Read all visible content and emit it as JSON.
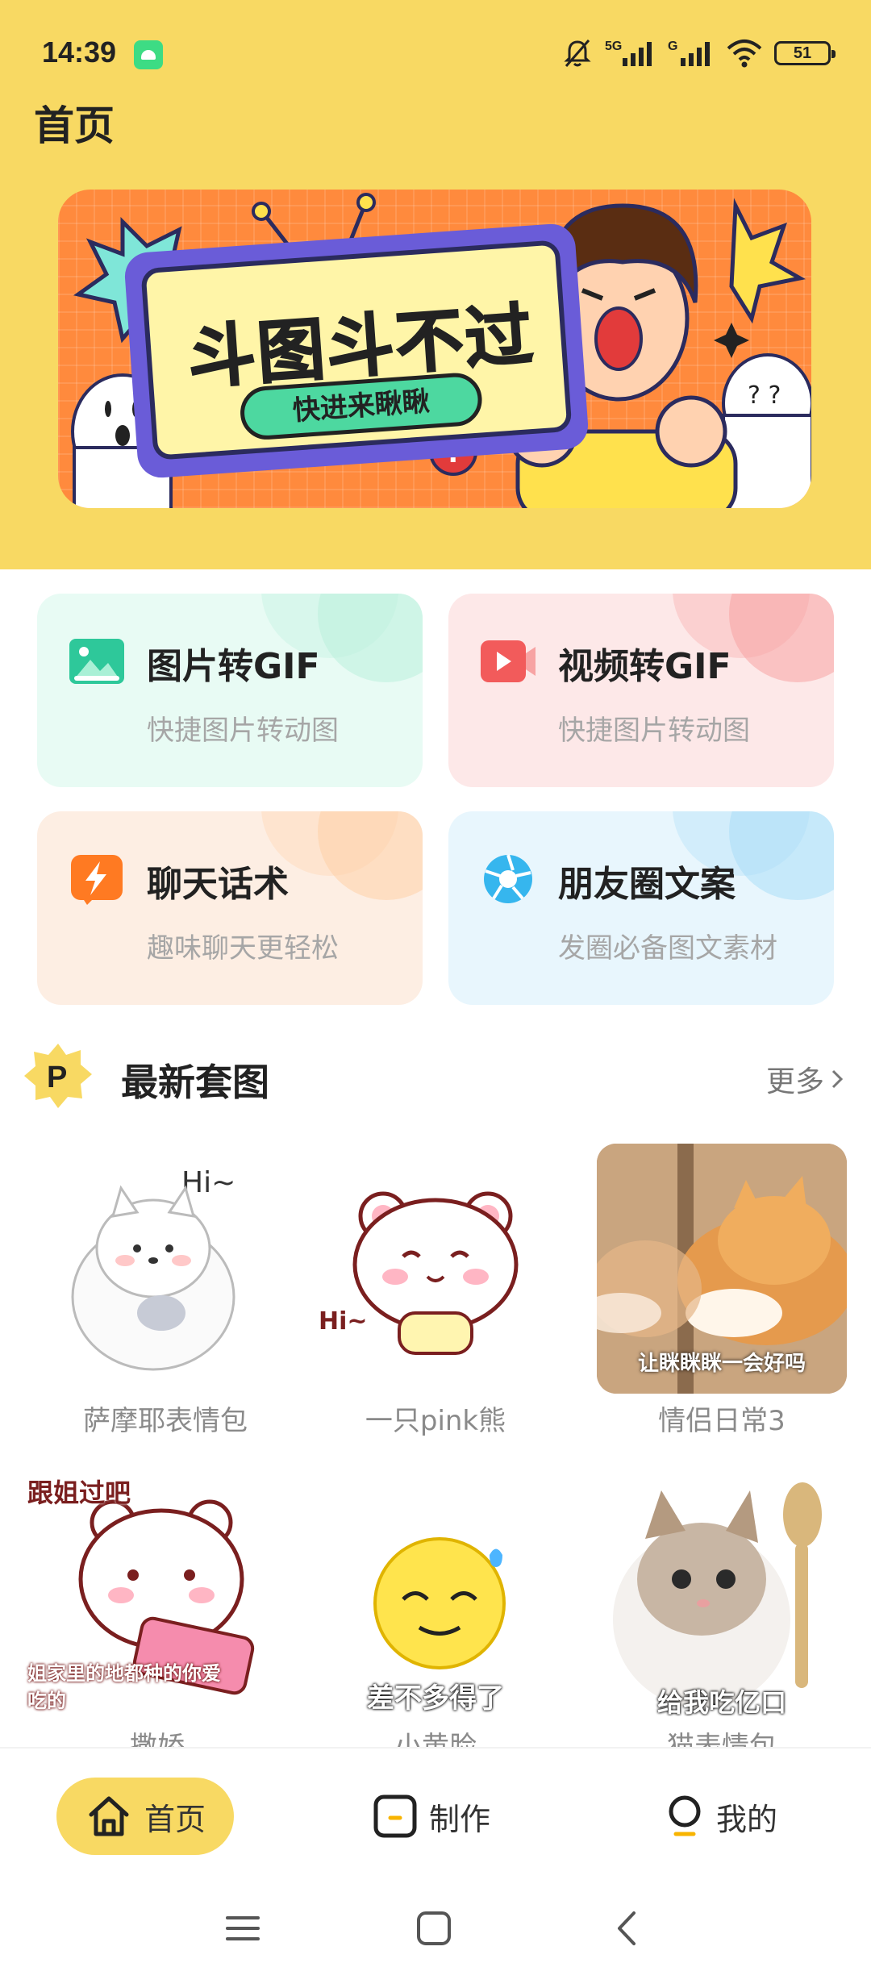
{
  "status_bar": {
    "time": "14:39",
    "battery": "51",
    "network_1": "5G",
    "network_2": "G"
  },
  "header": {
    "title": "首页"
  },
  "banner": {
    "title": "斗图斗不过",
    "subtitle": "快进来瞅瞅"
  },
  "features": [
    {
      "title": "图片转GIF",
      "subtitle": "快捷图片转动图",
      "icon": "image-icon",
      "bg": "#e8fbf4",
      "accent": "#2ec89a"
    },
    {
      "title": "视频转GIF",
      "subtitle": "快捷图片转动图",
      "icon": "video-icon",
      "bg": "#fde8e8",
      "accent": "#f25b5b"
    },
    {
      "title": "聊天话术",
      "subtitle": "趣味聊天更轻松",
      "icon": "lightning-icon",
      "bg": "#fdeee3",
      "accent": "#ff7a22"
    },
    {
      "title": "朋友圈文案",
      "subtitle": "发圈必备图文素材",
      "icon": "aperture-icon",
      "bg": "#e8f6fd",
      "accent": "#36b6ee"
    }
  ],
  "section": {
    "title": "最新套图",
    "more": "更多",
    "badge": "P"
  },
  "sets": [
    {
      "caption": "萨摩耶表情包",
      "overlay": ""
    },
    {
      "caption": "一只pink熊",
      "overlay": ""
    },
    {
      "caption": "情侣日常3",
      "overlay": "让眯眯眯一会好吗"
    },
    {
      "caption": "撒娇",
      "overlay": "跟姐过吧",
      "overlay2": "姐家里的地都种的你爱吃的"
    },
    {
      "caption": "小黄脸",
      "overlay": "差不多得了"
    },
    {
      "caption": "猫表情包",
      "overlay": "给我吃亿口"
    }
  ],
  "bottom_nav": [
    {
      "label": "首页",
      "icon": "home-icon",
      "active": true
    },
    {
      "label": "制作",
      "icon": "create-icon",
      "active": false
    },
    {
      "label": "我的",
      "icon": "profile-icon",
      "active": false
    }
  ],
  "colors": {
    "brand_yellow": "#f8d963",
    "text_primary": "#222222",
    "text_secondary": "#a6a6a6"
  }
}
